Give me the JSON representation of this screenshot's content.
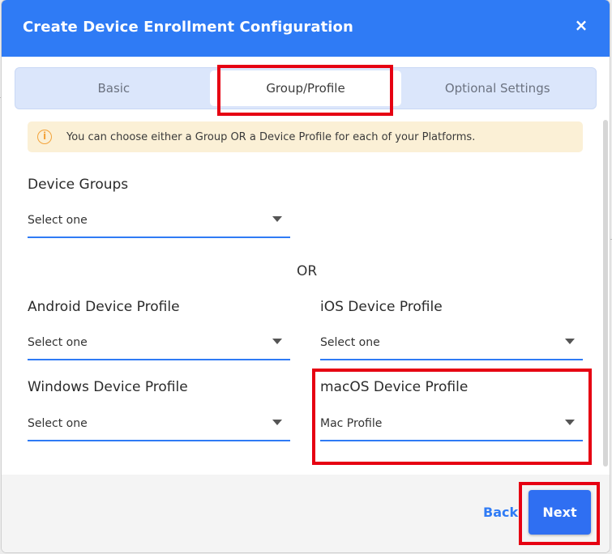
{
  "modal": {
    "title": "Create Device Enrollment Configuration",
    "close_symbol": "×"
  },
  "tabs": [
    {
      "label": "Basic",
      "active": false
    },
    {
      "label": "Group/Profile",
      "active": true
    },
    {
      "label": "Optional Settings",
      "active": false
    }
  ],
  "info": {
    "icon": "info-icon",
    "text": "You can choose either a Group OR a Device Profile for each of your Platforms."
  },
  "fields": {
    "device_groups": {
      "label": "Device Groups",
      "value": "Select one"
    },
    "or_text": "OR",
    "android_profile": {
      "label": "Android Device Profile",
      "value": "Select one"
    },
    "ios_profile": {
      "label": "iOS Device Profile",
      "value": "Select one"
    },
    "windows_profile": {
      "label": "Windows Device Profile",
      "value": "Select one"
    },
    "macos_profile": {
      "label": "macOS Device Profile",
      "value": "Mac Profile"
    }
  },
  "footer": {
    "back_label": "Back",
    "next_label": "Next"
  },
  "colors": {
    "header": "#2f7bf5",
    "highlight": "#e60012",
    "info_bg": "#fbf0d6",
    "accent": "#2f7bf5"
  }
}
